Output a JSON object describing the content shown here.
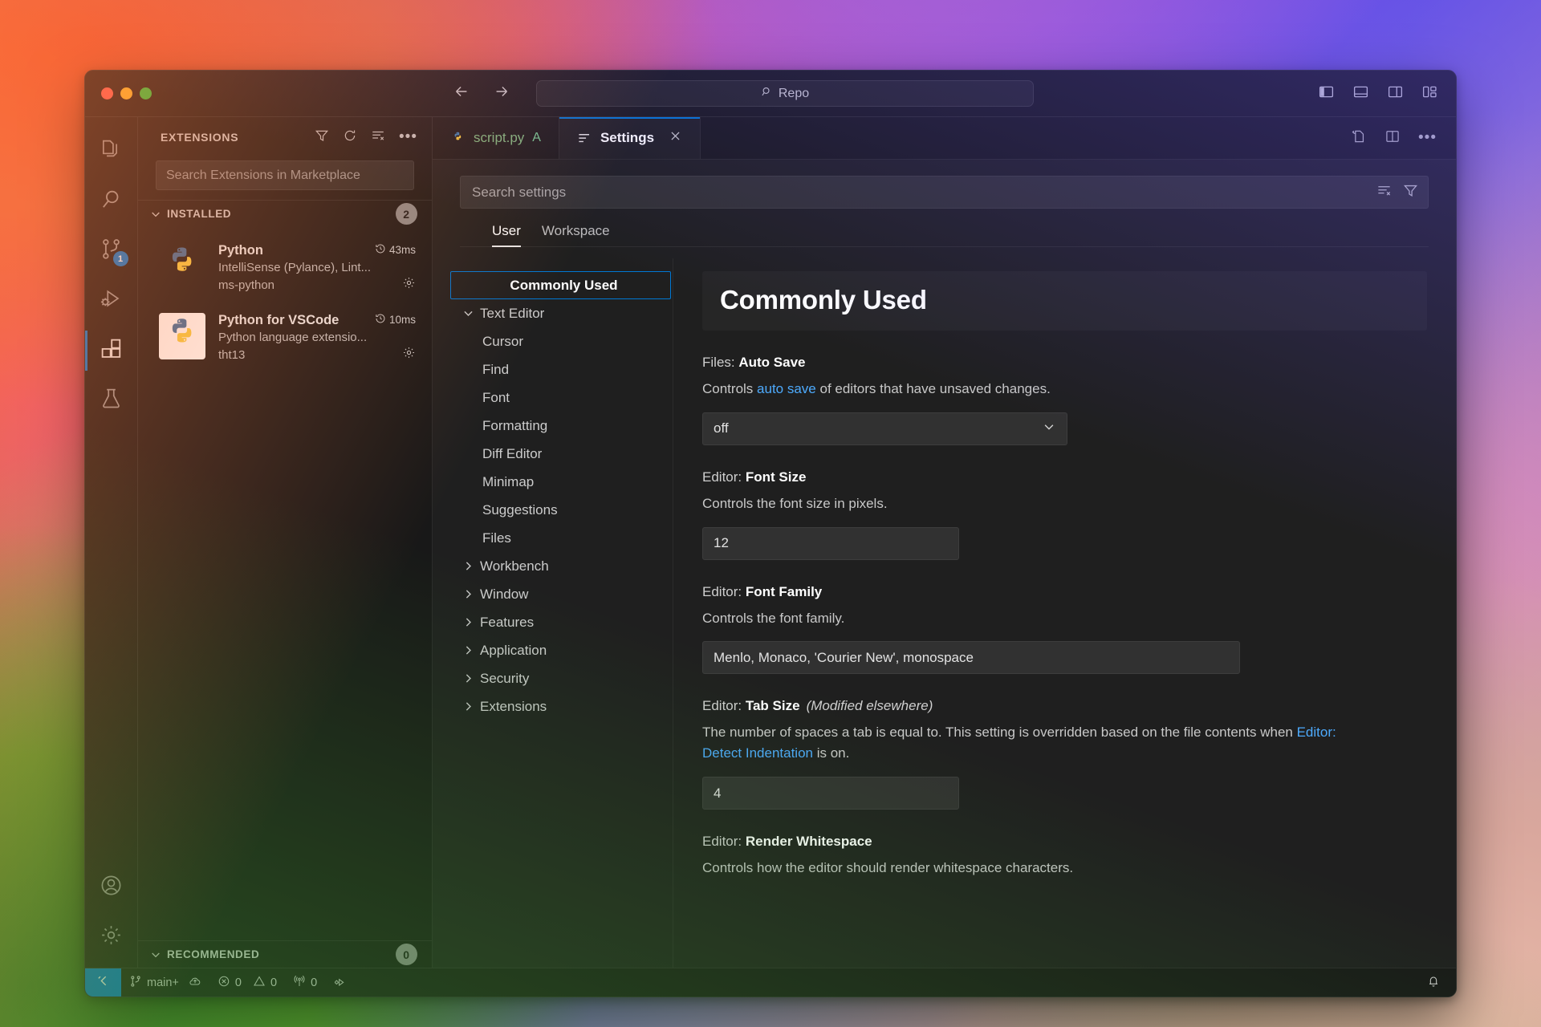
{
  "window": {
    "traffic_lights": [
      "close",
      "minimize",
      "zoom"
    ],
    "command_center_value": "Repo",
    "accent": "#0078d4"
  },
  "titlebar": {
    "back_icon": "arrow-left-icon",
    "forward_icon": "arrow-right-icon",
    "search_icon": "search-icon",
    "layout_icons": [
      "toggle-primary-sidebar-icon",
      "toggle-panel-icon",
      "toggle-secondary-sidebar-icon",
      "customize-layout-icon"
    ]
  },
  "activitybar": {
    "items": [
      {
        "name": "explorer",
        "icon": "files-icon",
        "active": false,
        "badge": null
      },
      {
        "name": "search",
        "icon": "search-icon",
        "active": false,
        "badge": null
      },
      {
        "name": "source-control",
        "icon": "source-control-icon",
        "active": false,
        "badge": "1"
      },
      {
        "name": "run-and-debug",
        "icon": "debug-icon",
        "active": false,
        "badge": null
      },
      {
        "name": "extensions",
        "icon": "extensions-icon",
        "active": true,
        "badge": null
      },
      {
        "name": "testing",
        "icon": "beaker-icon",
        "active": false,
        "badge": null
      }
    ],
    "bottom_items": [
      {
        "name": "accounts",
        "icon": "account-icon"
      },
      {
        "name": "manage",
        "icon": "gear-icon"
      }
    ]
  },
  "sidebar": {
    "title": "EXTENSIONS",
    "actions": [
      "filter-icon",
      "refresh-icon",
      "clear-list-icon",
      "more-actions-icon"
    ],
    "search_placeholder": "Search Extensions in Marketplace",
    "installed": {
      "label": "INSTALLED",
      "count": "2",
      "expanded": true
    },
    "extensions": [
      {
        "name": "Python",
        "time": "43ms",
        "description": "IntelliSense (Pylance), Lint...",
        "publisher": "ms-python",
        "icon": "python-logo",
        "icon_bg": "dark",
        "gear": "gear-icon",
        "clock": "history-icon"
      },
      {
        "name": "Python for VSCode",
        "time": "10ms",
        "description": "Python language extensio...",
        "publisher": "tht13",
        "icon": "python-logo",
        "icon_bg": "white",
        "gear": "gear-icon",
        "clock": "history-icon"
      }
    ],
    "recommended": {
      "label": "RECOMMENDED",
      "count": "0",
      "expanded": true
    }
  },
  "tabs": [
    {
      "label": "script.py",
      "git_badge": "A",
      "icon": "python-file-icon",
      "active": false,
      "closable": false
    },
    {
      "label": "Settings",
      "git_badge": "",
      "icon": "settings-editor-icon",
      "active": true,
      "closable": true
    }
  ],
  "editor_actions": [
    "open-changes-icon",
    "split-editor-icon",
    "more-actions-icon"
  ],
  "settings": {
    "search_placeholder": "Search settings",
    "search_icons": [
      "clear-filters-icon",
      "filter-icon"
    ],
    "scope_tabs": [
      {
        "label": "User",
        "active": true
      },
      {
        "label": "Workspace",
        "active": false
      }
    ],
    "toc": [
      {
        "label": "Commonly Used",
        "level": "root",
        "selected": true,
        "twisty": "none"
      },
      {
        "label": "Text Editor",
        "level": "group",
        "selected": false,
        "twisty": "down"
      },
      {
        "label": "Cursor",
        "level": "child",
        "selected": false,
        "twisty": "none"
      },
      {
        "label": "Find",
        "level": "child",
        "selected": false,
        "twisty": "none"
      },
      {
        "label": "Font",
        "level": "child",
        "selected": false,
        "twisty": "none"
      },
      {
        "label": "Formatting",
        "level": "child",
        "selected": false,
        "twisty": "none"
      },
      {
        "label": "Diff Editor",
        "level": "child",
        "selected": false,
        "twisty": "none"
      },
      {
        "label": "Minimap",
        "level": "child",
        "selected": false,
        "twisty": "none"
      },
      {
        "label": "Suggestions",
        "level": "child",
        "selected": false,
        "twisty": "none"
      },
      {
        "label": "Files",
        "level": "child",
        "selected": false,
        "twisty": "none"
      },
      {
        "label": "Workbench",
        "level": "group",
        "selected": false,
        "twisty": "right"
      },
      {
        "label": "Window",
        "level": "group",
        "selected": false,
        "twisty": "right"
      },
      {
        "label": "Features",
        "level": "group",
        "selected": false,
        "twisty": "right"
      },
      {
        "label": "Application",
        "level": "group",
        "selected": false,
        "twisty": "right"
      },
      {
        "label": "Security",
        "level": "group",
        "selected": false,
        "twisty": "right"
      },
      {
        "label": "Extensions",
        "level": "group",
        "selected": false,
        "twisty": "right"
      }
    ],
    "banner_title": "Commonly Used",
    "items": [
      {
        "prefix": "Files: ",
        "name": "Auto Save",
        "modified_note": "",
        "desc_parts": [
          {
            "t": "Controls ",
            "link": false
          },
          {
            "t": "auto save",
            "link": true
          },
          {
            "t": " of editors that have unsaved changes.",
            "link": false
          }
        ],
        "control": {
          "kind": "select",
          "value": "off",
          "chevron": "chevron-down-icon"
        }
      },
      {
        "prefix": "Editor: ",
        "name": "Font Size",
        "modified_note": "",
        "desc_parts": [
          {
            "t": "Controls the font size in pixels.",
            "link": false
          }
        ],
        "control": {
          "kind": "input-short",
          "value": "12"
        }
      },
      {
        "prefix": "Editor: ",
        "name": "Font Family",
        "modified_note": "",
        "desc_parts": [
          {
            "t": "Controls the font family.",
            "link": false
          }
        ],
        "control": {
          "kind": "input-long",
          "value": "Menlo, Monaco, 'Courier New', monospace"
        }
      },
      {
        "prefix": "Editor: ",
        "name": "Tab Size",
        "modified_note": "(Modified elsewhere)",
        "desc_parts": [
          {
            "t": "The number of spaces a tab is equal to. This setting is overridden based on the file contents when ",
            "link": false
          },
          {
            "t": "Editor: Detect Indentation",
            "link": true
          },
          {
            "t": " is on.",
            "link": false
          }
        ],
        "control": {
          "kind": "input-short",
          "value": "4"
        }
      },
      {
        "prefix": "Editor: ",
        "name": "Render Whitespace",
        "modified_note": "",
        "desc_parts": [
          {
            "t": "Controls how the editor should render whitespace characters.",
            "link": false
          }
        ],
        "control": {
          "kind": "none",
          "value": ""
        }
      }
    ]
  },
  "statusbar": {
    "remote_icon": "remote-window-icon",
    "branch": "main+",
    "branch_icon": "source-control-icon",
    "sync_icon": "cloud-sync-icon",
    "errors": "0",
    "error_icon": "error-icon",
    "warnings": "0",
    "warning_icon": "warning-icon",
    "ports": "0",
    "ports_icon": "radio-tower-icon",
    "run_icon": "run-task-icon",
    "bell_icon": "bell-icon"
  }
}
